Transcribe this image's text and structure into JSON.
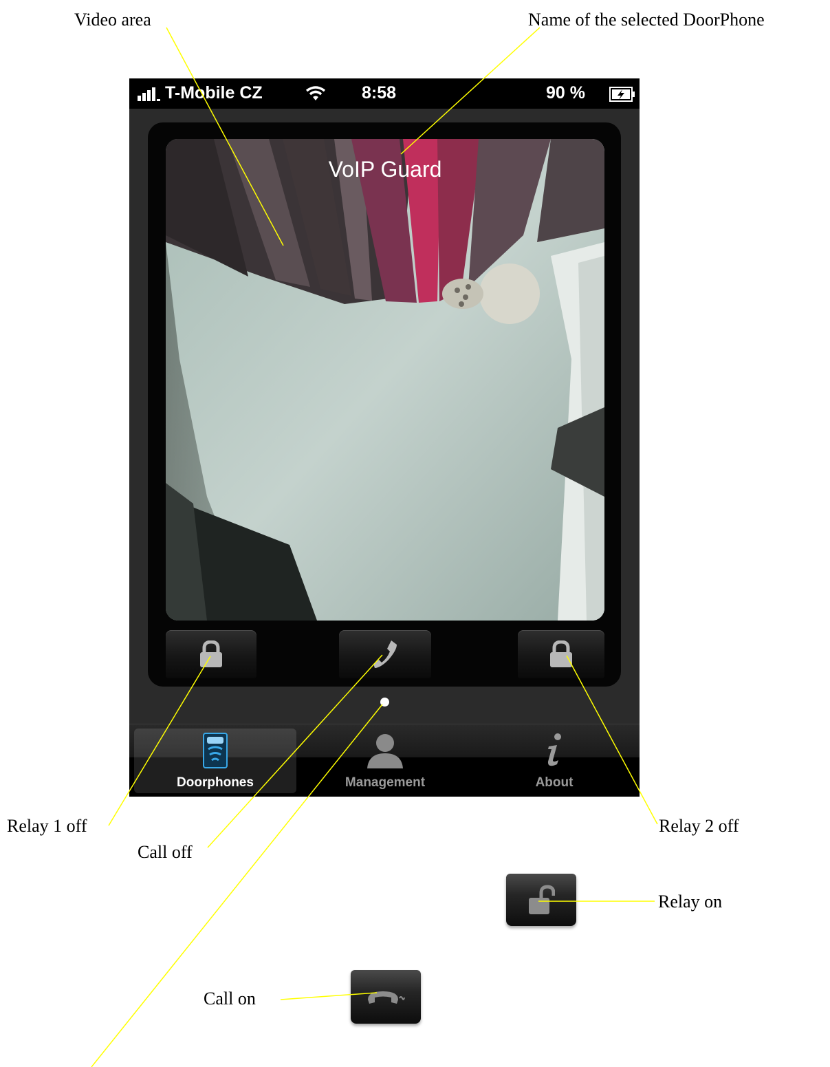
{
  "callouts": {
    "video_area": "Video area",
    "doorphone_name": "Name of the selected DoorPhone",
    "relay1_off": "Relay 1 off",
    "call_off": "Call off",
    "relay2_off": "Relay 2 off",
    "relay_on": "Relay on",
    "call_on": "Call on"
  },
  "status_bar": {
    "carrier": "T-Mobile CZ",
    "time": "8:58",
    "battery": "90 %"
  },
  "video": {
    "doorphone_name": "VoIP Guard"
  },
  "controls": {
    "relay1_icon": "lock-icon",
    "call_icon": "phone-handset-icon",
    "relay2_icon": "lock-icon"
  },
  "tabs": [
    {
      "label": "Doorphones",
      "icon": "doorphone-icon",
      "active": true
    },
    {
      "label": "Management",
      "icon": "person-icon",
      "active": false
    },
    {
      "label": "About",
      "icon": "info-icon",
      "active": false
    }
  ],
  "extra_buttons": {
    "relay_on_icon": "unlocked-lock-icon",
    "call_on_icon": "hang-up-icon"
  },
  "colors": {
    "annotation_line": "#ffff00",
    "doorphones_icon": "#38a8e8"
  }
}
